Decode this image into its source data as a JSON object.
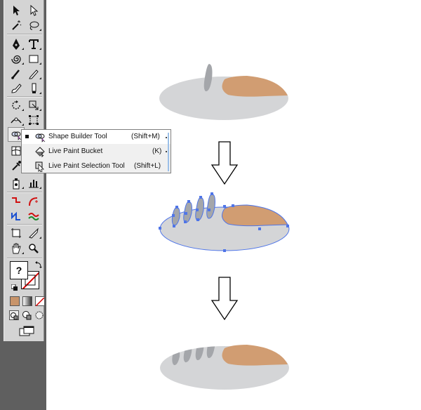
{
  "toolbar": {
    "tools": [
      "selection-tool",
      "direct-selection-tool",
      "magic-wand-tool",
      "lasso-tool",
      "pen-tool",
      "type-tool",
      "spiral-tool",
      "rectangle-tool",
      "paintbrush-tool",
      "pencil-tool",
      "blob-brush-tool",
      "eraser-tool",
      "rotate-tool",
      "scale-tool",
      "width-tool",
      "free-transform-tool",
      "shape-builder-tool",
      "perspective-grid-tool",
      "mesh-tool",
      "gradient-tool",
      "eyedropper-tool",
      "blend-tool",
      "symbol-sprayer-tool",
      "column-graph-tool",
      "artboard-tool",
      "slice-tool",
      "hand-tool",
      "zoom-tool"
    ],
    "fill_stroke_icon": "?",
    "colors": {
      "fill": "#c8946a",
      "stroke_none": "#d40000"
    }
  },
  "flyout": {
    "items": [
      {
        "label": "Shape Builder Tool",
        "shortcut": "(Shift+M)",
        "selected": true,
        "icon": "shape-builder-icon"
      },
      {
        "label": "Live Paint Bucket",
        "shortcut": "(K)",
        "selected": false,
        "icon": "live-paint-bucket-icon"
      },
      {
        "label": "Live Paint Selection Tool",
        "shortcut": "(Shift+L)",
        "selected": false,
        "icon": "live-paint-selection-icon"
      }
    ]
  },
  "canvas": {
    "colors": {
      "shoe_body": "#d4d5d7",
      "toe_cap": "#d19d72",
      "stripe": "#a4a6aa",
      "selection": "#4f75e8",
      "arrow": "#000000"
    }
  }
}
